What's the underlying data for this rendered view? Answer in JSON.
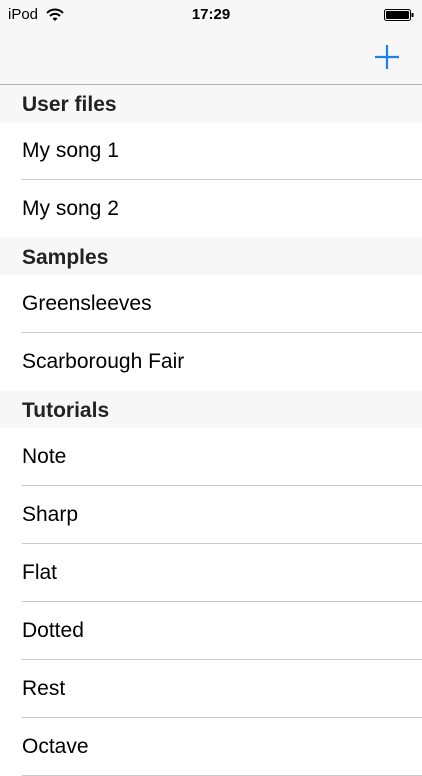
{
  "status_bar": {
    "carrier": "iPod",
    "time": "17:29"
  },
  "nav": {
    "add_icon": "plus-icon",
    "accent_color": "#1a82e8"
  },
  "sections": [
    {
      "title": "User files",
      "items": [
        "My song 1",
        "My song 2"
      ]
    },
    {
      "title": "Samples",
      "items": [
        "Greensleeves",
        "Scarborough Fair"
      ]
    },
    {
      "title": "Tutorials",
      "items": [
        "Note",
        "Sharp",
        "Flat",
        "Dotted",
        "Rest",
        "Octave"
      ]
    }
  ]
}
